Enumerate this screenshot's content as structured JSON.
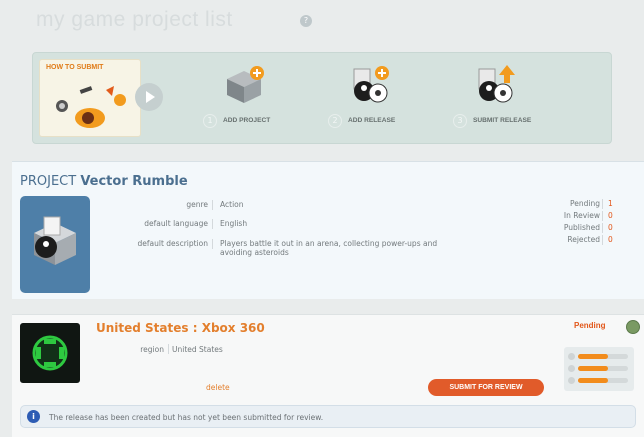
{
  "header": {
    "title": "my game project list"
  },
  "steps": {
    "how_to_label": "HOW TO SUBMIT",
    "items": [
      {
        "num": "1",
        "label": "ADD PROJECT"
      },
      {
        "num": "2",
        "label": "ADD RELEASE"
      },
      {
        "num": "3",
        "label": "SUBMIT RELEASE"
      }
    ]
  },
  "project": {
    "prefix": "PROJECT",
    "name": "Vector Rumble",
    "fields": [
      {
        "key": "genre",
        "value": "Action"
      },
      {
        "key": "default language",
        "value": "English"
      },
      {
        "key": "default description",
        "value": "Players battle it out in an arena, collecting power-ups and avoiding asteroids"
      }
    ],
    "stats": [
      {
        "key": "Pending",
        "value": "1"
      },
      {
        "key": "In Review",
        "value": "0"
      },
      {
        "key": "Published",
        "value": "0"
      },
      {
        "key": "Rejected",
        "value": "0"
      }
    ]
  },
  "release": {
    "title": "United States : Xbox 360",
    "region_key": "region",
    "region_value": "United States",
    "status": "Pending",
    "progress": [
      0.6,
      0.6,
      0.6
    ],
    "delete_label": "delete",
    "submit_label": "SUBMIT FOR REVIEW",
    "info_text": "The release has been created but has not yet been submitted for review."
  },
  "colors": {
    "accent_orange": "#e37f2d",
    "link_blue": "#4b6f8f",
    "button_red": "#e15b2a"
  }
}
